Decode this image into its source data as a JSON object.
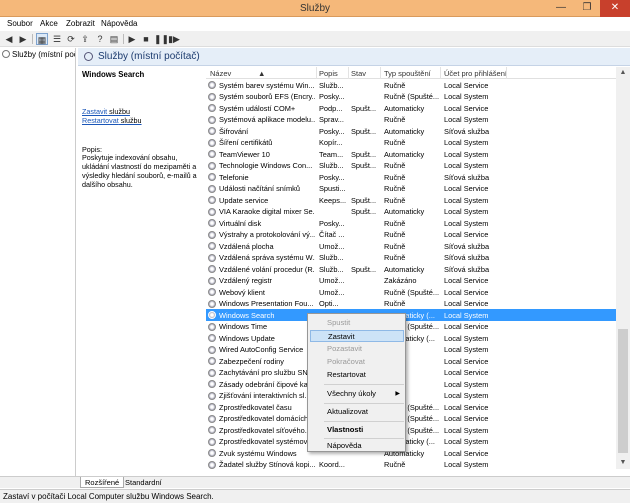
{
  "window": {
    "title": "Služby",
    "min": "—",
    "max": "❐",
    "close": "✕"
  },
  "menu": [
    "Soubor",
    "Akce",
    "Zobrazit",
    "Nápověda"
  ],
  "tree": {
    "item": "Služby (místní počít"
  },
  "header": {
    "title": "Služby (místní počítač)"
  },
  "description": {
    "service_name": "Windows Search",
    "stop_link": "Zastavit",
    "stop_rest": " službu",
    "restart_link": "Restartovat",
    "restart_rest": " službu",
    "desc_label": "Popis:",
    "desc_text": "Poskytuje indexování obsahu, ukládání vlastností do mezipaměti a výsledky hledání souborů, e-mailů a dalšího obsahu."
  },
  "columns": [
    "Název",
    "Popis",
    "Stav",
    "Typ spouštění",
    "Účet pro přihlášení"
  ],
  "rows": [
    {
      "name": "Systém barev systému Win...",
      "desc": "Služb...",
      "status": "",
      "startup": "Ručně",
      "account": "Local Service"
    },
    {
      "name": "Systém souborů EFS (Encry...",
      "desc": "Posky...",
      "status": "",
      "startup": "Ručně (Spušté...",
      "account": "Local System"
    },
    {
      "name": "Systém událostí COM+",
      "desc": "Podp...",
      "status": "Spušt...",
      "startup": "Automaticky",
      "account": "Local Service"
    },
    {
      "name": "Systémová aplikace modelu...",
      "desc": "Sprav...",
      "status": "",
      "startup": "Ručně",
      "account": "Local System"
    },
    {
      "name": "Šifrování",
      "desc": "Posky...",
      "status": "Spušt...",
      "startup": "Automaticky",
      "account": "Síťová služba"
    },
    {
      "name": "Šíření certifikátů",
      "desc": "Kopír...",
      "status": "",
      "startup": "Ručně",
      "account": "Local System"
    },
    {
      "name": "TeamViewer 10",
      "desc": "Team...",
      "status": "Spušt...",
      "startup": "Automaticky",
      "account": "Local System"
    },
    {
      "name": "Technologie Windows Con...",
      "desc": "Služb...",
      "status": "Spušt...",
      "startup": "Ručně",
      "account": "Local System"
    },
    {
      "name": "Telefonie",
      "desc": "Posky...",
      "status": "",
      "startup": "Ručně",
      "account": "Síťová služba"
    },
    {
      "name": "Události načítání snímků",
      "desc": "Spusti...",
      "status": "",
      "startup": "Ručně",
      "account": "Local Service"
    },
    {
      "name": "Update service",
      "desc": "Keeps...",
      "status": "Spušt...",
      "startup": "Ručně",
      "account": "Local System"
    },
    {
      "name": "VIA Karaoke digital mixer Se...",
      "desc": "",
      "status": "Spušt...",
      "startup": "Automaticky",
      "account": "Local System"
    },
    {
      "name": "Virtuální disk",
      "desc": "Posky...",
      "status": "",
      "startup": "Ručně",
      "account": "Local System"
    },
    {
      "name": "Výstrahy a protokolování vý...",
      "desc": "Čítač ...",
      "status": "",
      "startup": "Ručně",
      "account": "Local Service"
    },
    {
      "name": "Vzdálená plocha",
      "desc": "Umož...",
      "status": "",
      "startup": "Ručně",
      "account": "Síťová služba"
    },
    {
      "name": "Vzdálená správa systému W...",
      "desc": "Služb...",
      "status": "",
      "startup": "Ručně",
      "account": "Síťová služba"
    },
    {
      "name": "Vzdálené volání procedur (R...",
      "desc": "Služb...",
      "status": "Spušt...",
      "startup": "Automaticky",
      "account": "Síťová služba"
    },
    {
      "name": "Vzdálený registr",
      "desc": "Umož...",
      "status": "",
      "startup": "Zakázáno",
      "account": "Local Service"
    },
    {
      "name": "Webový klient",
      "desc": "Umož...",
      "status": "",
      "startup": "Ručně (Spušté...",
      "account": "Local Service"
    },
    {
      "name": "Windows Presentation Fou...",
      "desc": "Opti...",
      "status": "",
      "startup": "Ručně",
      "account": "Local Service"
    },
    {
      "name": "Windows Search",
      "desc": "",
      "status": "",
      "startup": "Automaticky (...",
      "account": "Local System",
      "selected": true
    },
    {
      "name": "Windows Time",
      "desc": "",
      "status": "",
      "startup": "Ručně (Spušté...",
      "account": "Local Service"
    },
    {
      "name": "Windows Update",
      "desc": "",
      "status": "",
      "startup": "Automaticky (...",
      "account": "Local System"
    },
    {
      "name": "Wired AutoConfig Service",
      "desc": "",
      "status": "",
      "startup": "Ručně",
      "account": "Local System"
    },
    {
      "name": "Zabezpečení rodiny",
      "desc": "",
      "status": "",
      "startup": "Ručně",
      "account": "Local Service"
    },
    {
      "name": "Zachytávání pro službu SN...",
      "desc": "",
      "status": "",
      "startup": "Ručně",
      "account": "Local Service"
    },
    {
      "name": "Zásady odebrání čipové ka...",
      "desc": "",
      "status": "",
      "startup": "Ručně",
      "account": "Local System"
    },
    {
      "name": "Zjišťování interaktivních sl...",
      "desc": "",
      "status": "",
      "startup": "Ručně",
      "account": "Local System"
    },
    {
      "name": "Zprostředkovatel času",
      "desc": "",
      "status": "",
      "startup": "Ručně (Spušté...",
      "account": "Local Service"
    },
    {
      "name": "Zprostředkovatel domácích...",
      "desc": "",
      "status": "",
      "startup": "Ručně (Spušté...",
      "account": "Local Service"
    },
    {
      "name": "Zprostředkovatel síťového...",
      "desc": "",
      "status": "",
      "startup": "Ručně (Spušté...",
      "account": "Local System"
    },
    {
      "name": "Zprostředkovatel systémov...",
      "desc": "",
      "status": "",
      "startup": "Automaticky (...",
      "account": "Local System"
    },
    {
      "name": "Zvuk systému Windows",
      "desc": "",
      "status": "",
      "startup": "Automaticky",
      "account": "Local Service"
    },
    {
      "name": "Žadatel služby Stínová kopi...",
      "desc": "Koord...",
      "status": "",
      "startup": "Ručně",
      "account": "Local System"
    }
  ],
  "context_menu": {
    "start": "Spustit",
    "stop": "Zastavit",
    "pause": "Pozastavit",
    "resume": "Pokračovat",
    "restart": "Restartovat",
    "all_tasks": "Všechny úkoly",
    "refresh": "Aktualizovat",
    "properties": "Vlastnosti",
    "help": "Nápověda"
  },
  "tabs": [
    "Rozšířené",
    "Standardní"
  ],
  "status": "Zastaví v počítači Local Computer službu Windows Search."
}
